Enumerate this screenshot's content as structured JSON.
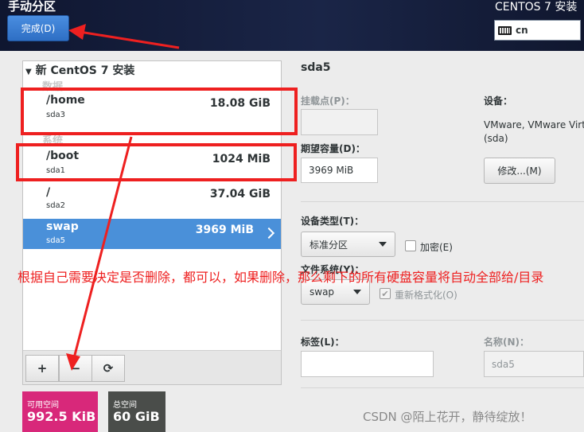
{
  "header": {
    "title": "手动分区",
    "done_button": "完成(D)",
    "installer_title": "CENTOS 7 安装",
    "keyboard_layout": "cn"
  },
  "partition_list": {
    "root_label": "新 CentOS 7 安装",
    "categories": {
      "data": "数据",
      "system": "系统"
    },
    "rows": [
      {
        "mount": "/home",
        "device": "sda3",
        "size": "18.08 GiB"
      },
      {
        "mount": "/boot",
        "device": "sda1",
        "size": "1024 MiB"
      },
      {
        "mount": "/",
        "device": "sda2",
        "size": "37.04 GiB"
      },
      {
        "mount": "swap",
        "device": "sda5",
        "size": "3969 MiB",
        "selected": true
      }
    ],
    "toolbar": {
      "add": "+",
      "remove": "−",
      "reload": "⟳"
    }
  },
  "space": {
    "available_label": "可用空间",
    "available_value": "992.5 KiB",
    "total_label": "总空间",
    "total_value": "60 GiB",
    "available_color": "#d8287a",
    "total_color": "#4a4d4a"
  },
  "detail": {
    "title": "sda5",
    "mount_point_label": "挂载点(P)：",
    "mount_point_value": "",
    "desired_capacity_label": "期望容量(D)：",
    "desired_capacity_value": "3969 MiB",
    "device_label": "设备：",
    "device_value_line1": "VMware, VMware Virt",
    "device_value_line2": "(sda)",
    "modify_button": "修改...(M)",
    "device_type_label": "设备类型(T)：",
    "device_type_value": "标准分区",
    "encrypt_label": "加密(E)",
    "fs_label": "文件系统(Y)：",
    "fs_value": "swap",
    "reformat_label": "重新格式化(O)",
    "tag_label": "标签(L)：",
    "tag_value": "",
    "name_label": "名称(N)：",
    "name_value": "sda5"
  },
  "annotation": {
    "note": "根据自己需要决定是否删除，都可以，如果删除，那么剩下的所有硬盘容量将自动全部给/目录"
  },
  "watermark": "CSDN @陌上花开，静待绽放！",
  "colors": {
    "accent": "#4a90d9",
    "annotation_red": "#ee2020"
  }
}
